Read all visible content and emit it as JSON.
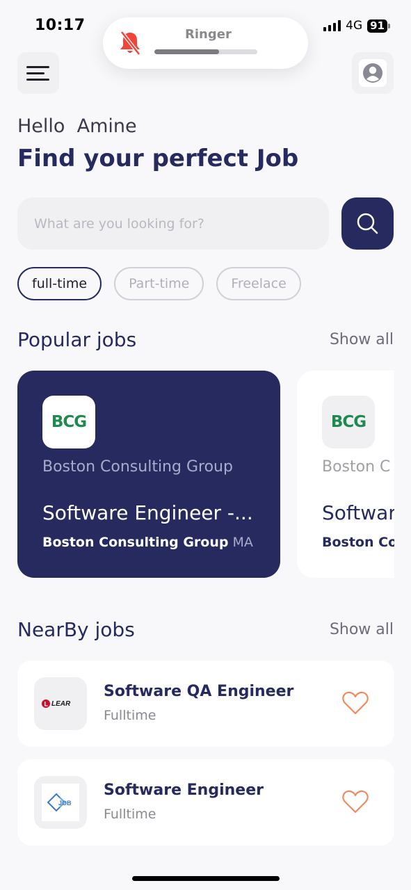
{
  "status_bar": {
    "time": "10:17",
    "network": "4G",
    "battery": "91"
  },
  "ringer": {
    "label": "Ringer",
    "level": 0.63
  },
  "greeting": "Hello  Amine",
  "headline": "Find your perfect Job",
  "search": {
    "placeholder": "What are you looking for?"
  },
  "filters": [
    {
      "label": "full-time",
      "active": true
    },
    {
      "label": "Part-time",
      "active": false
    },
    {
      "label": "Freelace",
      "active": false
    }
  ],
  "popular": {
    "title": "Popular jobs",
    "show_all": "Show all",
    "cards": [
      {
        "logo_text": "BCG",
        "company": "Boston Consulting Group",
        "title": "Software Engineer -...",
        "location_company": "Boston Consulting Group",
        "location_state": "MA"
      },
      {
        "logo_text": "BCG",
        "company": "Boston C",
        "title": "Softwar",
        "location_company": "Boston Co",
        "location_state": ""
      }
    ]
  },
  "nearby": {
    "title": "NearBy jobs",
    "show_all": "Show all",
    "items": [
      {
        "title": "Software QA Engineer",
        "type": "Fulltime",
        "logo_text": "LEAR"
      },
      {
        "title": "Software Engineer",
        "type": "Fulltime",
        "logo_text": "JOB"
      }
    ]
  },
  "colors": {
    "primary": "#262a5e",
    "accent_heart": "#f08a5d",
    "bcg_green": "#1e8a4f"
  }
}
